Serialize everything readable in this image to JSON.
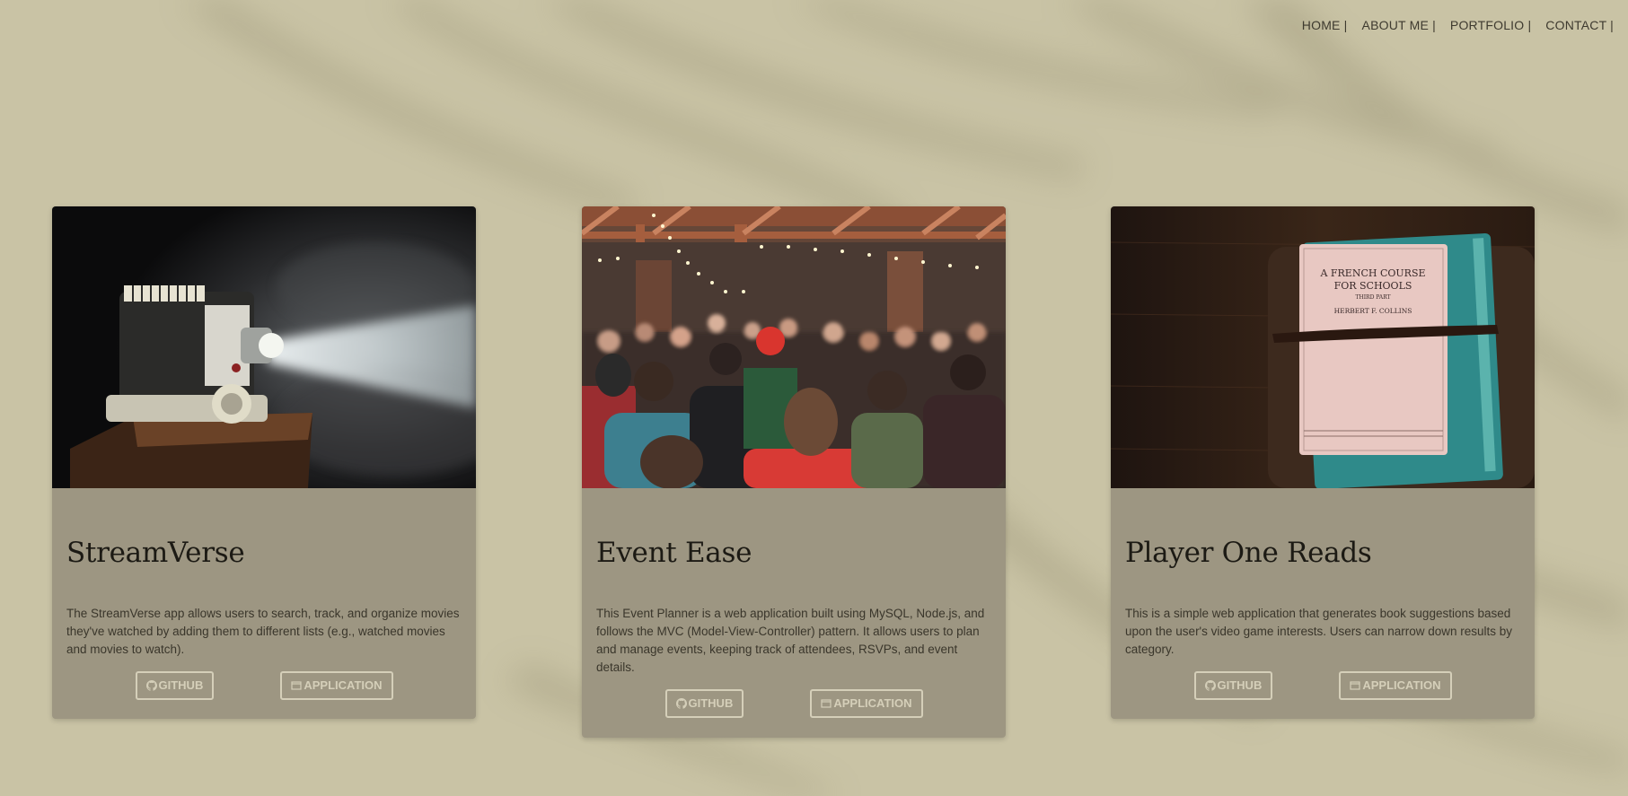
{
  "nav": {
    "items": [
      {
        "label": "HOME |"
      },
      {
        "label": "ABOUT ME |"
      },
      {
        "label": "PORTFOLIO |"
      },
      {
        "label": "CONTACT |"
      }
    ]
  },
  "projects": [
    {
      "title": "StreamVerse",
      "description": "The StreamVerse app allows users to search, track, and organize movies they've watched by adding them to different lists (e.g., watched movies and movies to watch).",
      "github_label": "GITHUB",
      "app_label": "APPLICATION",
      "image": "film-projector-photo"
    },
    {
      "title": "Event Ease",
      "description": "This Event Planner is a web application built using MySQL, Node.js, and follows the MVC (Model-View-Controller) pattern. It allows users to plan and manage events, keeping track of attendees, RSVPs, and event details.",
      "github_label": "GITHUB",
      "app_label": "APPLICATION",
      "image": "crowd-party-photo"
    },
    {
      "title": "Player One Reads",
      "description": "This is a simple web application that generates book suggestions based upon the user's video game interests. Users can narrow down results by category.",
      "github_label": "GITHUB",
      "app_label": "APPLICATION",
      "image": "old-books-photo",
      "book_cover_text": {
        "line1": "A FRENCH COURSE",
        "line2": "FOR SCHOOLS",
        "line3": "THIRD PART",
        "line4": "HERBERT F. COLLINS"
      }
    }
  ],
  "colors": {
    "background": "#c9c3a5",
    "card": "#9d9682",
    "button_border": "#d5cfb9",
    "title_text": "#1c1a14"
  }
}
